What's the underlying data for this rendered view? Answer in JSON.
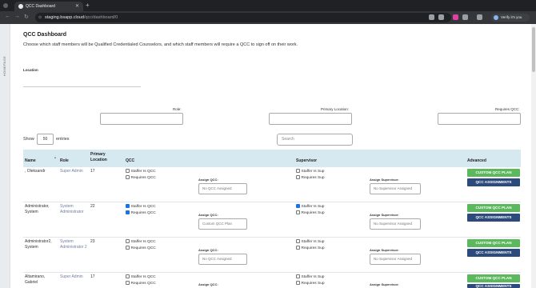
{
  "browser": {
    "tab_title": "QCC Dashboard",
    "url_host": "staging.bsapp.cloud",
    "url_path": "/qcc/dashboard/0",
    "profile_label": "Verify it's you"
  },
  "sidebar": {
    "label": "HOMEPAGE"
  },
  "page": {
    "title": "QCC Dashboard",
    "subtitle": "Choose which staff members will be Qualified Credentialed Counselors, and which staff members will require a QCC to sign off on their work."
  },
  "filters": {
    "location_label": "Location",
    "role_label": "Role:",
    "primary_location_label": "Primary Location:",
    "requires_qcc_label": "Requires QCC:"
  },
  "table_controls": {
    "show_label": "Show",
    "page_size": "50",
    "entries_label": "entries",
    "search_placeholder": "Search"
  },
  "table": {
    "headers": {
      "name": "Name",
      "role": "Role",
      "primary_location": "Primary Location",
      "qcc": "QCC",
      "supervisor": "Supervisor",
      "advanced": "Advanced"
    },
    "labels": {
      "staffer_is_qcc": "Staffer Is QCC",
      "requires_qcc": "Requires QCC",
      "staffer_is_sup": "Staffer Is Sup",
      "requires_sup": "Requires Sup",
      "assign_qcc": "Assign QCC:",
      "assign_supervisor": "Assign Supervisor:",
      "custom_qcc_plan": "CUSTOM QCC PLAN",
      "qcc_assignments": "QCC ASSIGNMENTS"
    },
    "rows": [
      {
        "name": ", Oleksandr",
        "role": "Super Admin",
        "location": "17",
        "staffer_is_qcc": false,
        "requires_qcc": false,
        "assign_qcc": "No QCC Assigned",
        "staffer_is_sup": false,
        "requires_sup": false,
        "assign_supervisor": "No Supervisor Assigned"
      },
      {
        "name": "Administrator, System",
        "role": "System Administrator",
        "location": "22",
        "staffer_is_qcc": true,
        "requires_qcc": true,
        "assign_qcc": "Custom QCC Plan",
        "staffer_is_sup": true,
        "requires_sup": false,
        "assign_supervisor": "No Supervisor Assigned"
      },
      {
        "name": "Administrator2, System",
        "role": "System Administrator 2",
        "location": "23",
        "staffer_is_qcc": false,
        "requires_qcc": false,
        "assign_qcc": "No QCC Assigned",
        "staffer_is_sup": false,
        "requires_sup": false,
        "assign_supervisor": "No Supervisor Assigned"
      },
      {
        "name": "Altamirano, Gabriel",
        "role": "Super Admin",
        "location": "17",
        "staffer_is_qcc": false,
        "requires_qcc": false,
        "assign_qcc": "",
        "staffer_is_sup": false,
        "requires_sup": false,
        "assign_supervisor": ""
      }
    ]
  }
}
